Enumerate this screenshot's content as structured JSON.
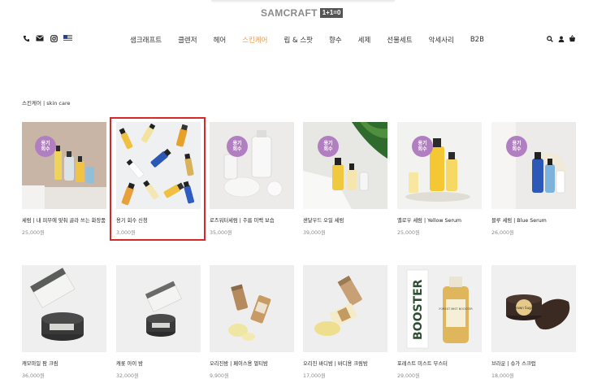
{
  "brand": {
    "name": "SAMCRAFT",
    "tag": "1+1=0"
  },
  "nav": {
    "items": [
      "샘크래프트",
      "클렌저",
      "헤어",
      "스킨케어",
      "립 & 스팟",
      "향수",
      "세제",
      "선물세트",
      "악세사리",
      "B2B"
    ],
    "active_index": 3
  },
  "utility_icons": [
    "phone-icon",
    "mail-icon",
    "instagram-icon",
    "flag-icon"
  ],
  "right_icons": [
    "search-icon",
    "user-icon",
    "cart-icon"
  ],
  "breadcrumb": "스킨케어 | skin care",
  "badge_text": [
    "용기",
    "회수"
  ],
  "colors": {
    "accent": "#e89b4f",
    "badge": "#b27ec2",
    "highlight": "#d62828"
  },
  "products": [
    {
      "name": "세럼 | 내 피부에 맞춰 골라 쓰는 화장품",
      "price": "25,000원",
      "badge": true
    },
    {
      "name": "용기 회수 신청",
      "price": "3,000원",
      "badge": false
    },
    {
      "name": "로즈워터세럼 | 주름 미백 보습",
      "price": "35,000원",
      "badge": true
    },
    {
      "name": "샌달우드 오일 세럼",
      "price": "39,000원",
      "badge": true
    },
    {
      "name": "옐로우 세럼 | Yellow Serum",
      "price": "25,000원",
      "badge": true
    },
    {
      "name": "블루 세럼 | Blue Serum",
      "price": "26,000원",
      "badge": true
    },
    {
      "name": "캐모마일 팜 크림",
      "price": "36,000원",
      "badge": false
    },
    {
      "name": "캐롯 아이 밤",
      "price": "32,000원",
      "badge": false
    },
    {
      "name": "오리진밤 | 페이스용 멀티밤",
      "price": "9,900원",
      "badge": false
    },
    {
      "name": "오리진 바디밤 | 바디용 크림밤",
      "price": "17,000원",
      "badge": false
    },
    {
      "name": "포레스트 미스트 부스터",
      "price": "29,000원",
      "badge": false
    },
    {
      "name": "브라운 | 슈가 스크럽",
      "price": "18,000원",
      "badge": false
    }
  ],
  "product_art": {
    "booster_label": "BOOSTER",
    "bottle_label": "FOREST MIST BOOSTER",
    "jar_label": "Brown Sugar"
  }
}
